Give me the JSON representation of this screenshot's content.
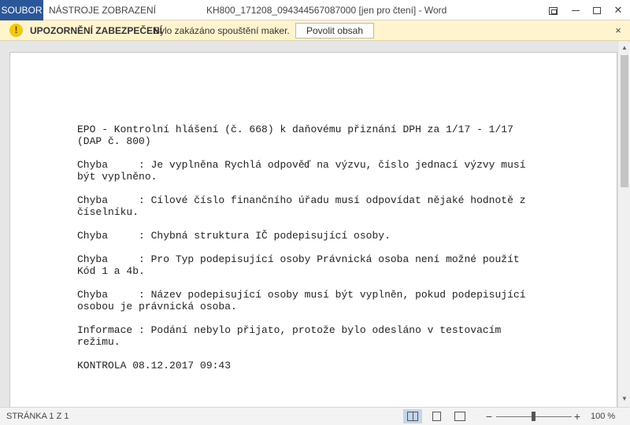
{
  "titlebar": {
    "file_tab": "SOUBOR",
    "tools_tab": "NÁSTROJE ZOBRAZENÍ",
    "window_title": "KH800_171208_094344567087000 [jen pro čtení] - Word"
  },
  "security_bar": {
    "title": "UPOZORNĚNÍ ZABEZPEČENÍ",
    "message": "Bylo zakázáno spouštění maker.",
    "button": "Povolit obsah",
    "close": "×"
  },
  "document": {
    "paragraphs": [
      "EPO - Kontrolní hlášení (č. 668) k daňovému přiznání DPH za 1/17 - 1/17\n(DAP č. 800)",
      "Chyba     : Je vyplněna Rychlá odpověď na výzvu, číslo jednací výzvy musí\nbýt vyplněno.",
      "Chyba     : Cílové číslo finančního úřadu musí odpovídat nějaké hodnotě z\nčíselníku.",
      "Chyba     : Chybná struktura IČ podepisující osoby.",
      "Chyba     : Pro Typ podepisující osoby Právnická osoba není možné použít\nKód 1 a 4b.",
      "Chyba     : Název podepisující osoby musí být vyplněn, pokud podepisující\nosobou je právnická osoba.",
      "Informace : Podání nebylo přijato, protože bylo odesláno v testovacím\nrežimu.",
      "KONTROLA 08.12.2017 09:43"
    ]
  },
  "statusbar": {
    "page_count": "STRÁNKA 1 Z 1",
    "zoom_minus": "−",
    "zoom_plus": "+",
    "zoom_level": "100 %",
    "zoom_fraction": 0.5
  },
  "icons": {
    "warning": "warning-icon",
    "read_mode": "read-mode-icon",
    "print_layout": "print-layout-icon",
    "web_layout": "web-layout-icon"
  },
  "colors": {
    "file_tab": "#2b579a",
    "security_bar": "#fff4ce",
    "warning_icon": "#f2c811"
  }
}
